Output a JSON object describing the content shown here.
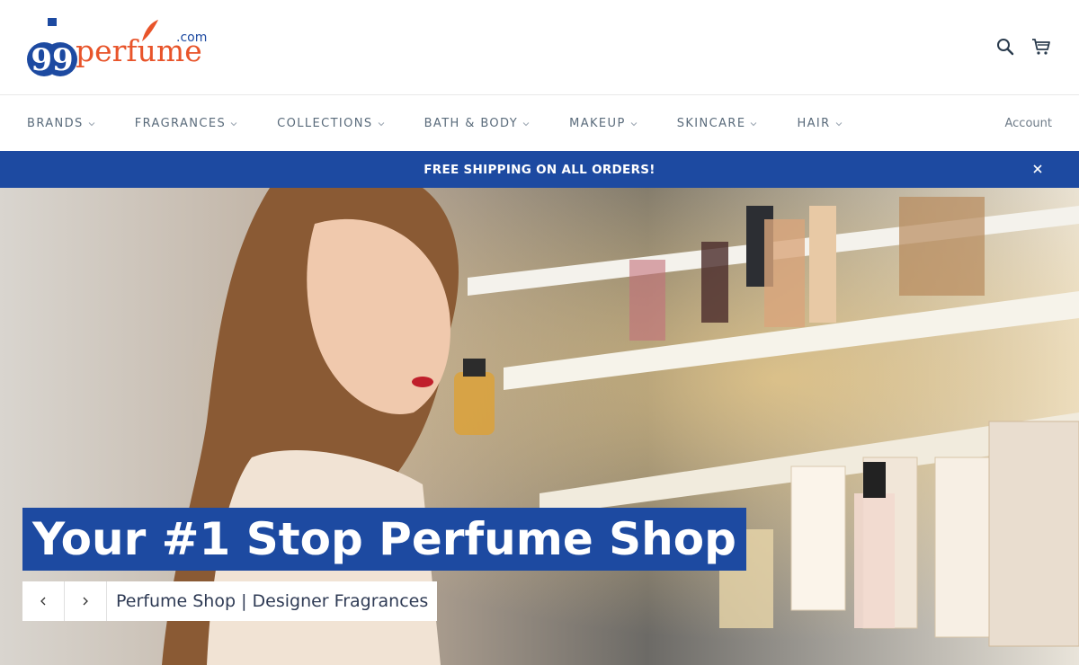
{
  "logo": {
    "text_number": "99",
    "text_word": "perfume",
    "text_tld": ".com",
    "brand_blue": "#1d4aa1",
    "brand_orange": "#e8542a"
  },
  "header": {
    "icons": [
      "search-icon",
      "cart-icon"
    ]
  },
  "nav": {
    "items": [
      {
        "label": "BRANDS"
      },
      {
        "label": "FRAGRANCES"
      },
      {
        "label": "COLLECTIONS"
      },
      {
        "label": "BATH & BODY"
      },
      {
        "label": "MAKEUP"
      },
      {
        "label": "SKINCARE"
      },
      {
        "label": "HAIR"
      }
    ],
    "account_label": "Account"
  },
  "announcement": {
    "text": "FREE SHIPPING ON ALL ORDERS!",
    "background": "#1d4aa1"
  },
  "hero": {
    "title": "Your #1 Stop Perfume Shop",
    "subtitle": "Perfume Shop | Designer Fragrances",
    "prev_icon": "chevron-left-icon",
    "next_icon": "chevron-right-icon"
  }
}
